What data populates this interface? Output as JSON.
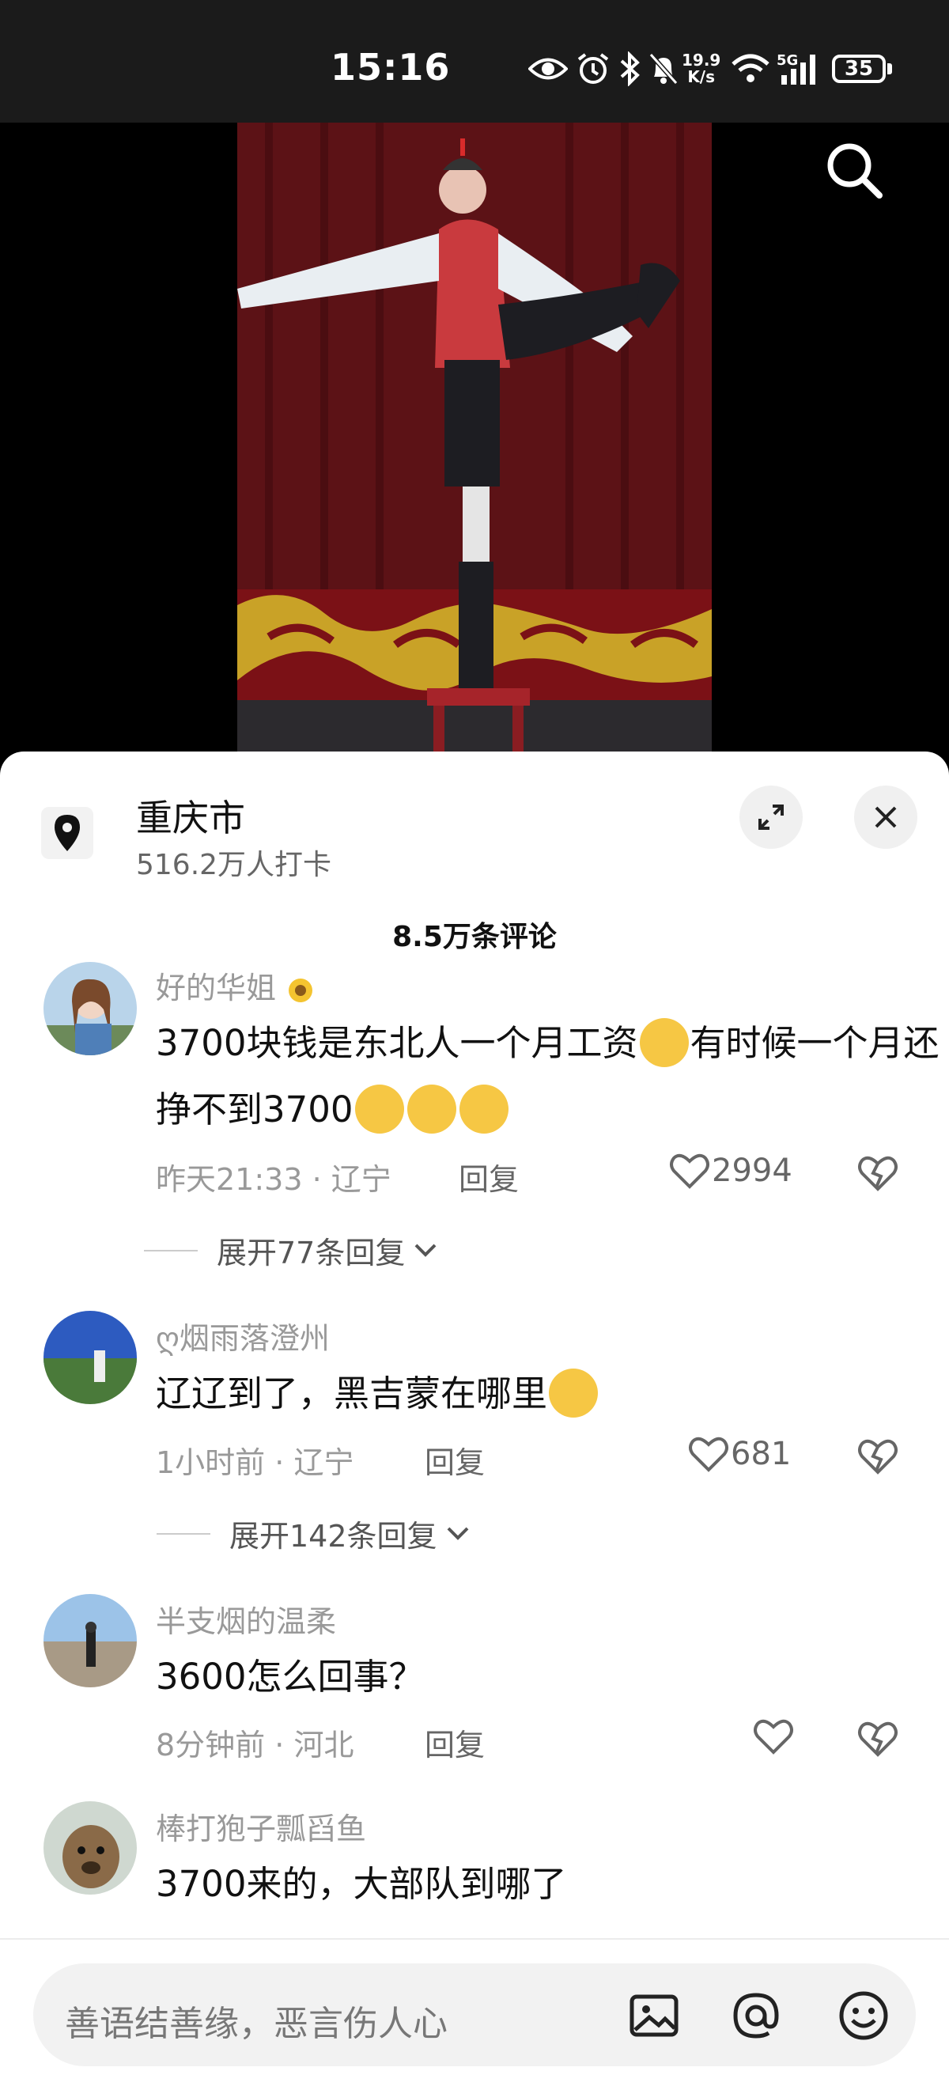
{
  "status_bar": {
    "time": "15:16",
    "net_speed_value": "19.9",
    "net_speed_unit": "K/s",
    "network": "5G",
    "battery": "35",
    "icons": [
      "eye-icon",
      "alarm-icon",
      "bluetooth-icon",
      "mute-icon",
      "wifi-icon",
      "signal-icon"
    ]
  },
  "location": {
    "name": "重庆市",
    "checkins": "516.2万人打卡"
  },
  "comment_count": "8.5万条评论",
  "comments": [
    {
      "name": "好的华姐",
      "text_part1": "3700块钱是东北人一个月工资",
      "text_part2": "有时候一个月还挣不到3700",
      "time": "昨天21:33",
      "region": "辽宁",
      "reply_label": "回复",
      "likes": "2994",
      "expand_label": "展开77条回复"
    },
    {
      "name": "ღ烟雨落澄州",
      "text": "辽辽到了，黑吉蒙在哪里",
      "time": "1小时前",
      "region": "辽宁",
      "reply_label": "回复",
      "likes": "681",
      "expand_label": "展开142条回复"
    },
    {
      "name": "半支烟的温柔",
      "text": "3600怎么回事？",
      "time": "8分钟前",
      "region": "河北",
      "reply_label": "回复",
      "likes": ""
    },
    {
      "name": "棒打狍子瓢舀鱼",
      "text": "3700来的，大部队到哪了"
    }
  ],
  "input": {
    "placeholder": "善语结善缘，恶言伤人心"
  },
  "colors": {
    "background_dark": "#1b1b1b",
    "sheet": "#ffffff",
    "muted_text": "#999999",
    "stage_red": "#6a1418",
    "stage_gold": "#c9a227"
  }
}
